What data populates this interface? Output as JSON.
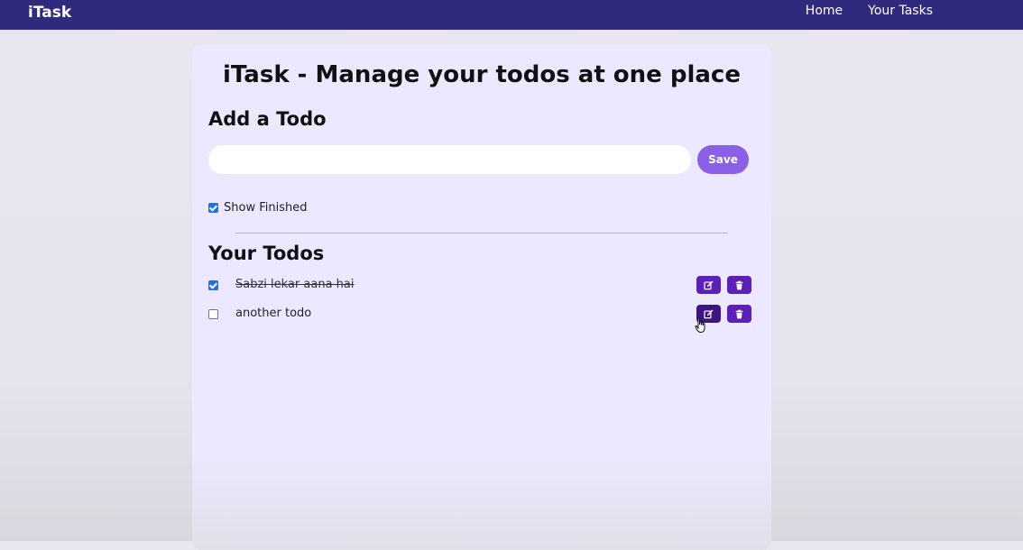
{
  "navbar": {
    "brand": "iTask",
    "links": [
      "Home",
      "Your Tasks"
    ]
  },
  "main": {
    "title": "iTask - Manage your todos at one place",
    "add_heading": "Add a Todo",
    "input_value": "",
    "save_label": "Save",
    "show_finished_label": "Show Finished",
    "show_finished_checked": true,
    "todos_heading": "Your Todos",
    "todos": [
      {
        "text": "Sabzi lekar aana hai",
        "completed": true
      },
      {
        "text": "another todo",
        "completed": false
      }
    ]
  },
  "icons": {
    "edit": "edit-icon",
    "delete": "trash-icon"
  },
  "colors": {
    "navbar": "#2f2a7e",
    "card": "#ece8ff",
    "save_button": "#8b5fe6",
    "action_button": "#5b21b6"
  }
}
